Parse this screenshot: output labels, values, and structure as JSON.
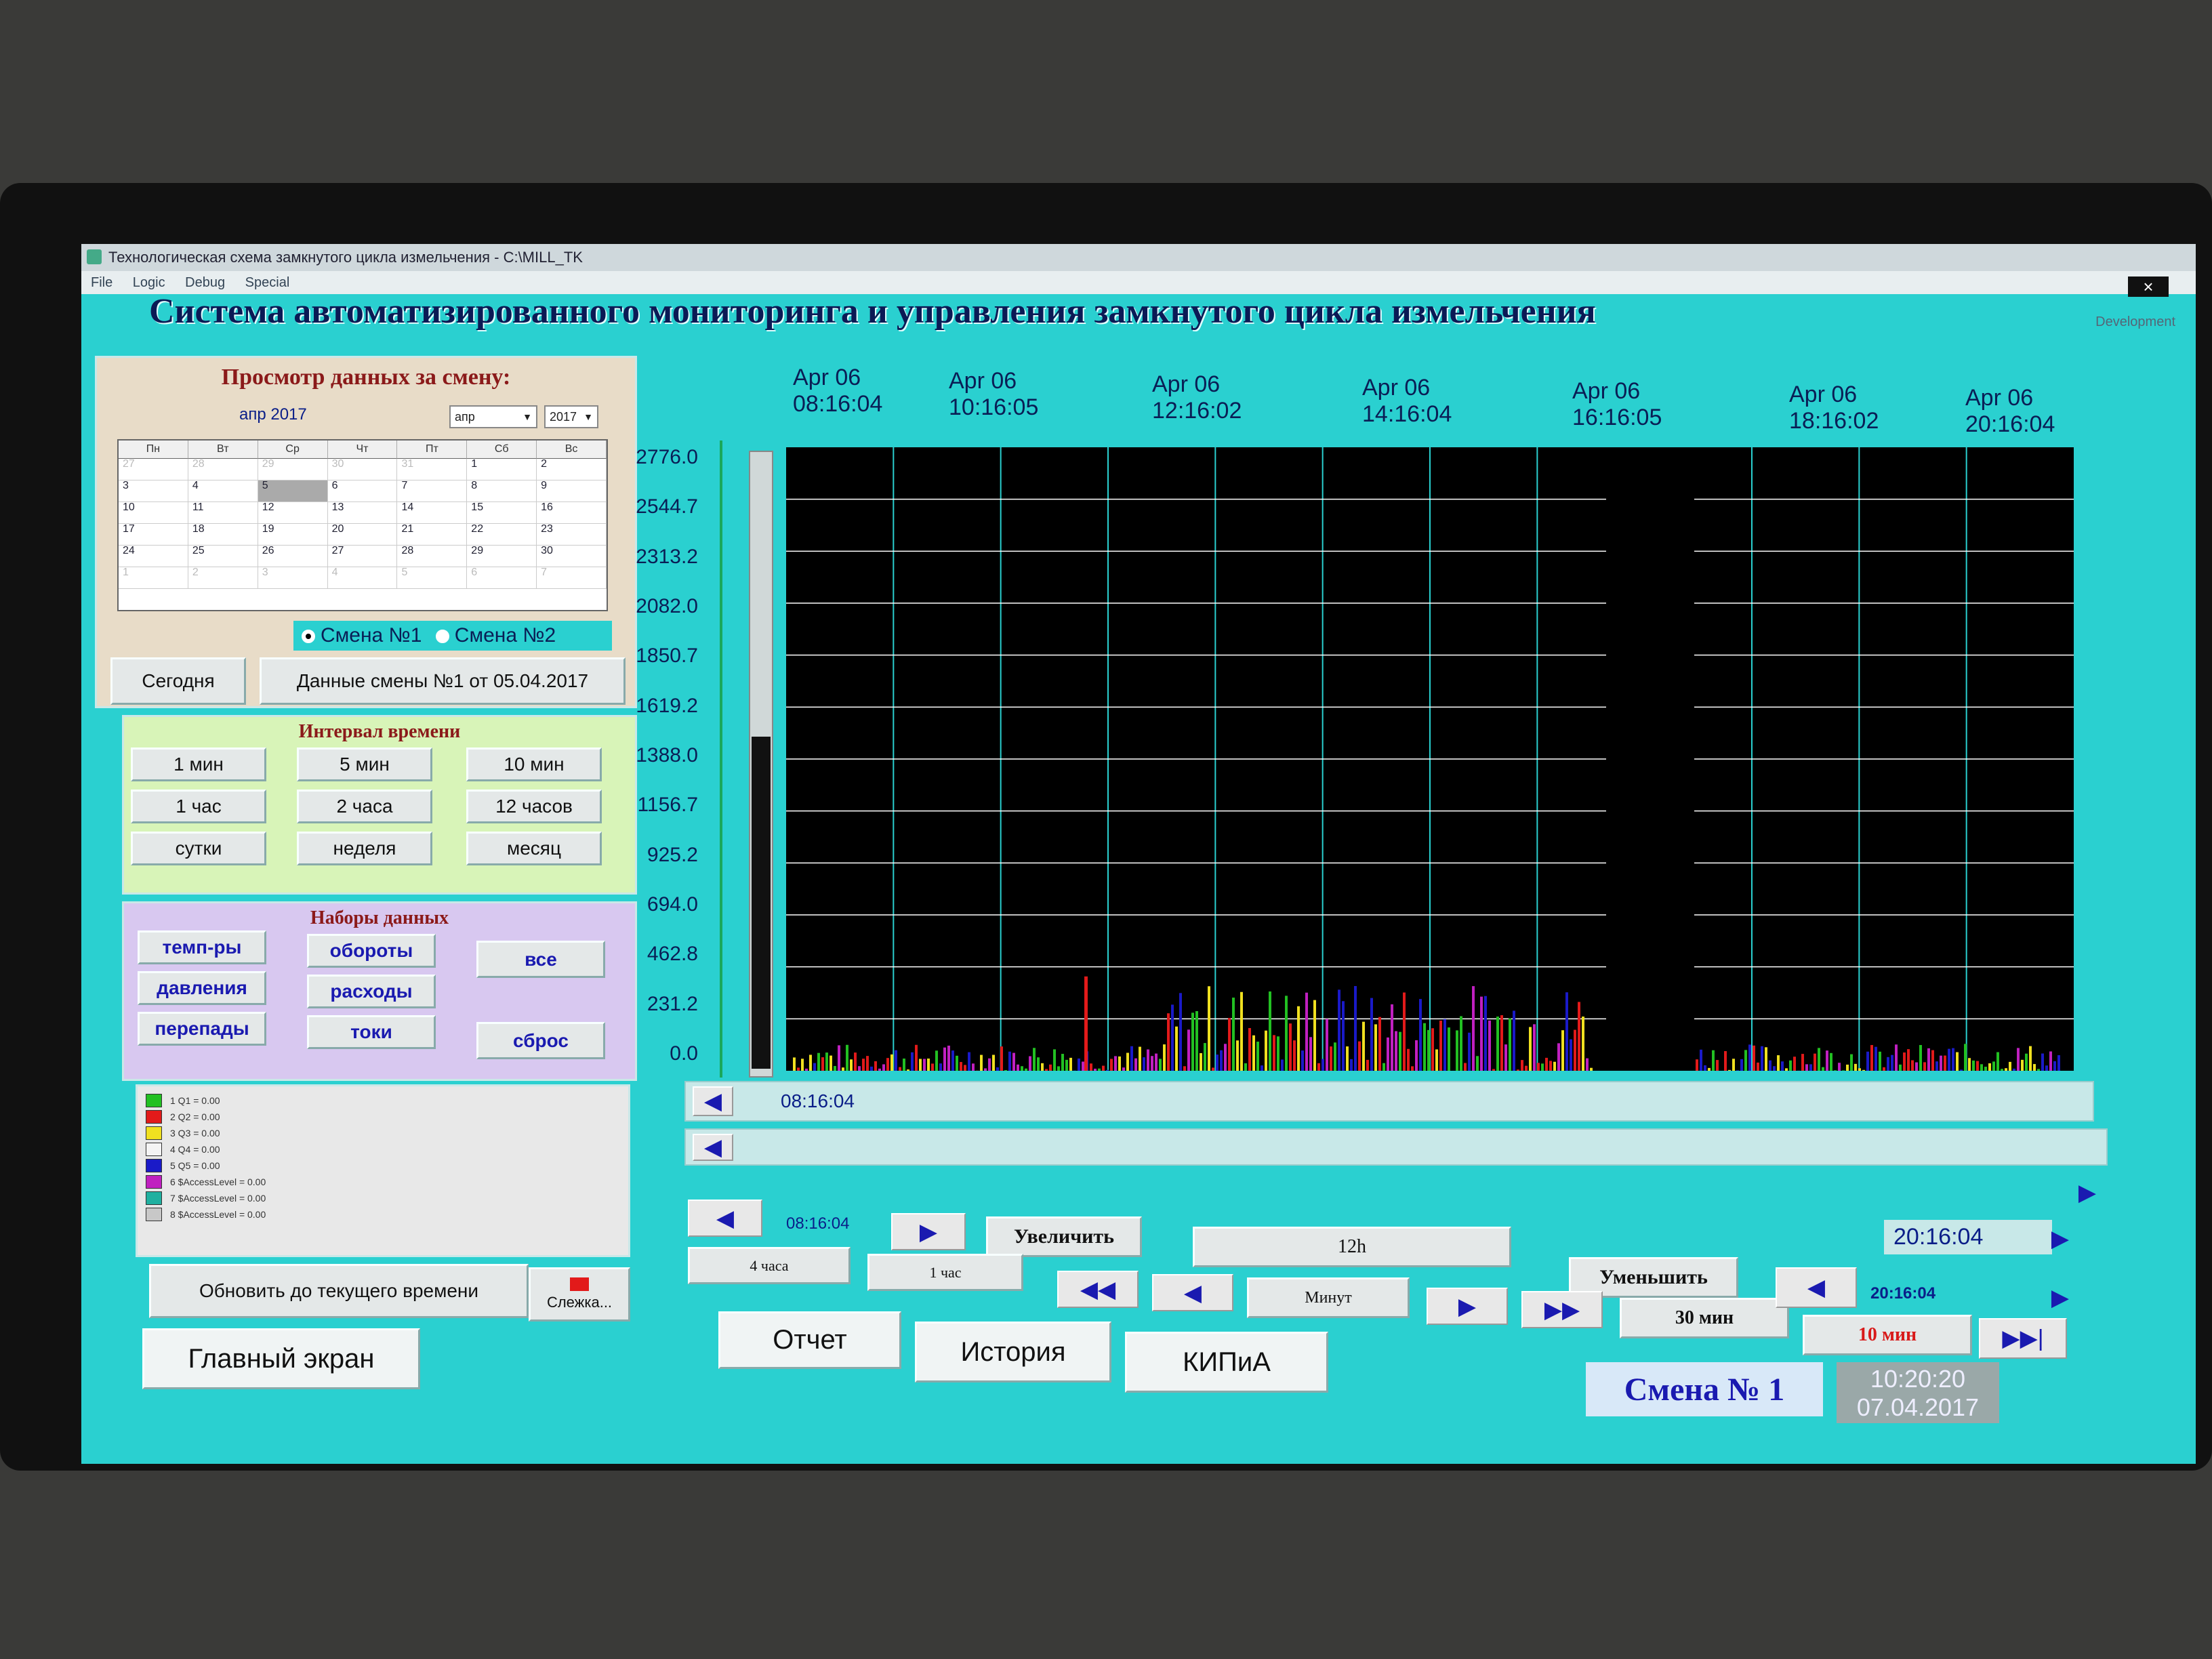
{
  "window": {
    "title": "Технологическая схема замкнутого цикла измельчения - C:\\MILL_TK",
    "menu": [
      "File",
      "Logic",
      "Debug",
      "Special"
    ],
    "close_label": "×",
    "dev_tag": "Development"
  },
  "header": {
    "title": "Система автоматизированного мониторинга и управления замкнутого цикла измельчения"
  },
  "shift_view": {
    "title": "Просмотр данных за смену:",
    "calendar": {
      "month_label": "апр 2017",
      "month_select": "апр",
      "year_select": "2017",
      "weekdays": [
        "Пн",
        "Вт",
        "Ср",
        "Чт",
        "Пт",
        "Сб",
        "Вс"
      ],
      "weeks": [
        [
          "27",
          "28",
          "29",
          "30",
          "31",
          "1",
          "2"
        ],
        [
          "3",
          "4",
          "5",
          "6",
          "7",
          "8",
          "9"
        ],
        [
          "10",
          "11",
          "12",
          "13",
          "14",
          "15",
          "16"
        ],
        [
          "17",
          "18",
          "19",
          "20",
          "21",
          "22",
          "23"
        ],
        [
          "24",
          "25",
          "26",
          "27",
          "28",
          "29",
          "30"
        ],
        [
          "1",
          "2",
          "3",
          "4",
          "5",
          "6",
          "7"
        ]
      ],
      "selected_day": "5"
    },
    "shift1_label": "Смена №1",
    "shift2_label": "Смена №2",
    "selected_shift": "Смена №1",
    "today_button": "Сегодня",
    "shift_data_button": "Данные смены №1 от 05.04.2017"
  },
  "interval": {
    "title": "Интервал времени",
    "buttons": [
      "1 мин",
      "5 мин",
      "10 мин",
      "1 час",
      "2 часа",
      "12 часов",
      "сутки",
      "неделя",
      "месяц"
    ]
  },
  "datasets": {
    "title": "Наборы данных",
    "buttons": [
      "темп-ры",
      "обороты",
      "все",
      "давления",
      "расходы",
      "перепады",
      "токи",
      "сброс"
    ]
  },
  "legend": {
    "items": [
      {
        "label": "1   Q1 = 0.00",
        "color": "#22c022"
      },
      {
        "label": "2   Q2 = 0.00",
        "color": "#e21a1a"
      },
      {
        "label": "3   Q3 = 0.00",
        "color": "#f0e020"
      },
      {
        "label": "4   Q4 = 0.00",
        "color": "#f4f4f4"
      },
      {
        "label": "5   Q5 = 0.00",
        "color": "#1a1ac8"
      },
      {
        "label": "6   $AccessLevel = 0.00",
        "color": "#c020c0"
      },
      {
        "label": "7   $AccessLevel = 0.00",
        "color": "#20b0a0"
      },
      {
        "label": "8   $AccessLevel = 0.00",
        "color": "#c8c8c8"
      }
    ]
  },
  "refresh_button": "Обновить до текущего времени",
  "tracking_button": "Слежка...",
  "main_screen_button": "Главный экран",
  "chart_data": {
    "type": "bar",
    "y_ticks": [
      "2776.0",
      "2544.7",
      "2313.2",
      "2082.0",
      "1850.7",
      "1619.2",
      "1388.0",
      "1156.7",
      "925.2",
      "694.0",
      "462.8",
      "231.2",
      "0.0"
    ],
    "ylim": [
      0,
      2776.0
    ],
    "x_ticks": [
      {
        "date": "Apr 06",
        "time": "08:16:04"
      },
      {
        "date": "Apr 06",
        "time": "10:16:05"
      },
      {
        "date": "Apr 06",
        "time": "12:16:02"
      },
      {
        "date": "Apr 06",
        "time": "14:16:04"
      },
      {
        "date": "Apr 06",
        "time": "16:16:05"
      },
      {
        "date": "Apr 06",
        "time": "18:16:02"
      },
      {
        "date": "Apr 06",
        "time": "20:16:04"
      }
    ],
    "background": "#000000",
    "grid": true,
    "grid_color": "#2ad0d0",
    "spike": {
      "time": "09:40",
      "value": 420,
      "color": "#e21a1a"
    },
    "series_colors": [
      "#22c022",
      "#e21a1a",
      "#f0e020",
      "#1a1ac8",
      "#c020c0"
    ]
  },
  "nav": {
    "start_time": "08:16:04",
    "end_time": "20:16:04",
    "zoom_in": "Увеличить",
    "zoom_out": "Уменьшить",
    "span_label": "12h",
    "step_4h": "4 часа",
    "step_1h": "1 час",
    "minutes_label": "Минут",
    "step_30m": "30 мин",
    "step_10m": "10 мин",
    "right_time": "20:16:04"
  },
  "bottom_tabs": [
    "Отчет",
    "История",
    "КИПиА"
  ],
  "status": {
    "shift": "Смена № 1",
    "time": "10:20:20",
    "date": "07.04.2017"
  }
}
